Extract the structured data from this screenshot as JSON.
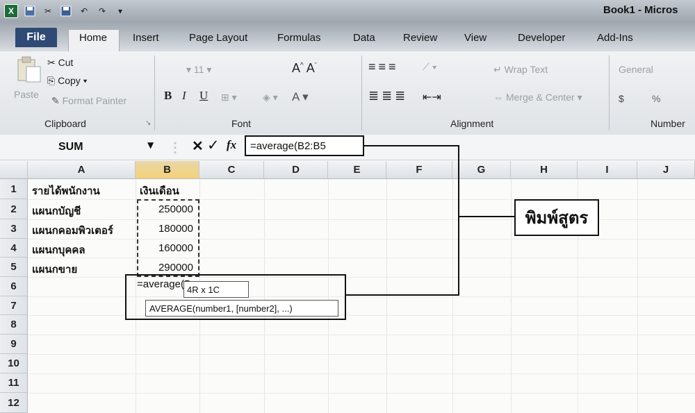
{
  "window": {
    "title": "Book1 - Micros"
  },
  "quick_access": {
    "icons": [
      "excel-logo-icon",
      "save-icon",
      "cut-icon",
      "save-icon",
      "undo-icon",
      "redo-icon",
      "customize-icon"
    ]
  },
  "tabs": {
    "file": "File",
    "items": [
      "Home",
      "Insert",
      "Page Layout",
      "Formulas",
      "Data",
      "Review",
      "View",
      "Developer",
      "Add-Ins"
    ]
  },
  "ribbon": {
    "clipboard": {
      "cut": "Cut",
      "copy": "Copy",
      "paste": "Paste",
      "format_painter": "Format Painter",
      "label": "Clipboard"
    },
    "font": {
      "label": "Font",
      "bold": "B",
      "italic": "I",
      "underline": "U",
      "size": "11"
    },
    "alignment": {
      "label": "Alignment",
      "wrap_text": "Wrap Text",
      "merge_center": "Merge & Center"
    },
    "number": {
      "label": "Number",
      "format": "General",
      "currency": "$",
      "percent": "%"
    }
  },
  "formula_bar": {
    "name_box": "SUM",
    "cancel": "✕",
    "enter": "✓",
    "fx": "fx",
    "formula": "=average(B2:B5"
  },
  "sheet": {
    "columns": [
      "A",
      "B",
      "C",
      "D",
      "E",
      "F",
      "G",
      "H",
      "I",
      "J"
    ],
    "rows": [
      "1",
      "2",
      "3",
      "4",
      "5",
      "6",
      "7",
      "8",
      "9",
      "10",
      "11",
      "12"
    ],
    "a1": "รายได้พนักงาน",
    "b1": "เงินเดือน",
    "data": [
      {
        "dept": "แผนกบัญชี",
        "salary": "250000"
      },
      {
        "dept": "แผนกคอมพิวเตอร์",
        "salary": "180000"
      },
      {
        "dept": "แผนกบุคคล",
        "salary": "160000"
      },
      {
        "dept": "แผนกขาย",
        "salary": "290000"
      }
    ],
    "editing_cell_text": "=average(B",
    "range_size_tip": "4R x 1C",
    "syntax_tip": "AVERAGE(number1, [number2], ...)"
  },
  "annotation": {
    "callout": "พิมพ์สูตร"
  },
  "colors": {
    "file_tab": "#2e4a75",
    "excel_green": "#1d6b3a",
    "selected_header": "#f5d27a"
  }
}
